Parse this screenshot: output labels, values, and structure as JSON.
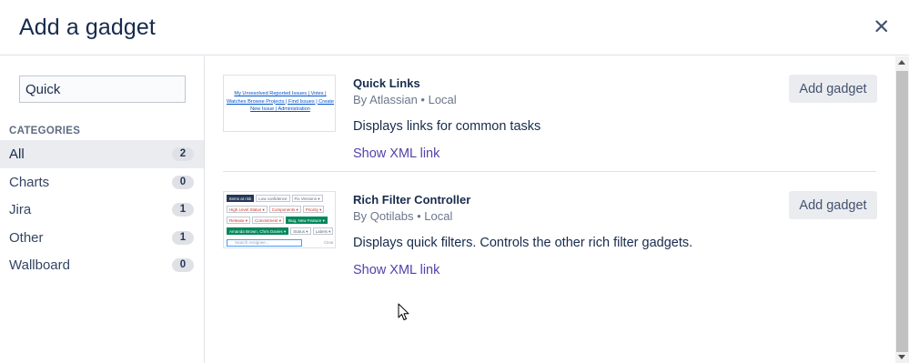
{
  "dialog": {
    "title": "Add a gadget",
    "close_icon": "close-icon"
  },
  "sidebar": {
    "search_value": "Quick",
    "categories_heading": "CATEGORIES",
    "categories": [
      {
        "label": "All",
        "count": "2",
        "active": true
      },
      {
        "label": "Charts",
        "count": "0"
      },
      {
        "label": "Jira",
        "count": "1"
      },
      {
        "label": "Other",
        "count": "1"
      },
      {
        "label": "Wallboard",
        "count": "0"
      }
    ]
  },
  "gadgets": [
    {
      "name": "Quick Links",
      "author": "By Atlassian • Local",
      "description": "Displays links for common tasks",
      "xml_link": "Show XML link",
      "add_label": "Add gadget",
      "thumb_text": "My Unresolved Reported Issues | Votes | Watches Browse Projects | Find Issues | Create New Issue | Administration"
    },
    {
      "name": "Rich Filter Controller",
      "author": "By Qotilabs • Local",
      "description": "Displays quick filters. Controls the other rich filter gadgets.",
      "xml_link": "Show XML link",
      "add_label": "Add gadget",
      "thumb": {
        "row1": [
          "Items at risk",
          "Low confidence",
          "Fix Versions ▾"
        ],
        "row2": [
          "High Level Status ▾",
          "Components ▾",
          "Priority ▾"
        ],
        "row3": [
          "Release ▾",
          "Commitment ▾",
          "Bug, New Feature ▾"
        ],
        "row4": [
          "Amanda Brown, Chris Davies ▾",
          "Status ▾",
          "Labels ▾"
        ],
        "search_placeholder": "Search Assignee...",
        "clear": "Clear"
      }
    }
  ],
  "colors": {
    "link": "#5243aa",
    "button_bg": "#ebecf0",
    "active_category_bg": "#ebecf0"
  }
}
